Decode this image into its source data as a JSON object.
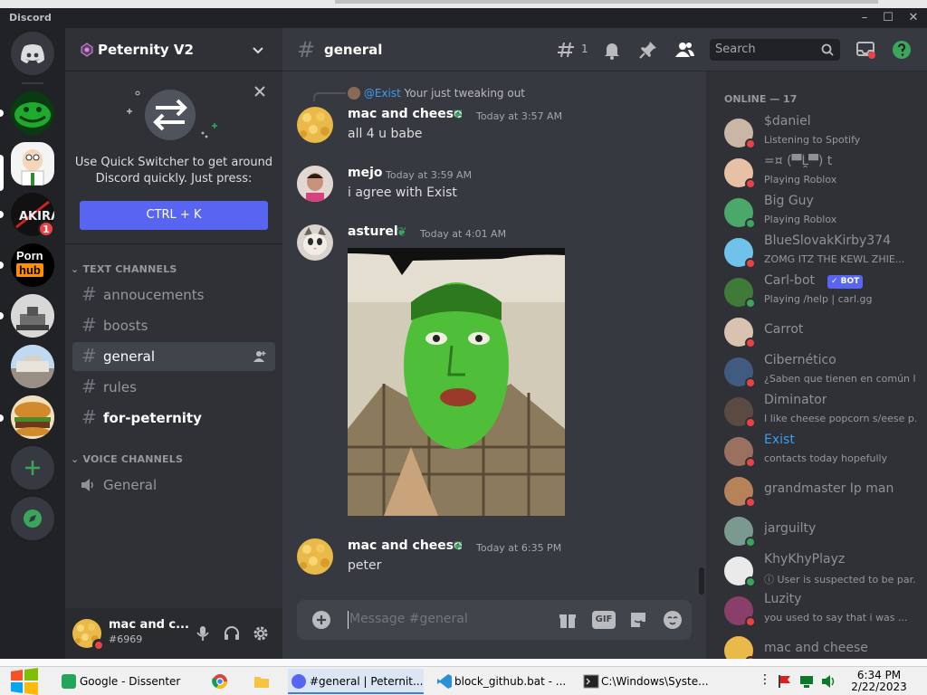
{
  "window": {
    "brand": "Discord",
    "minimize": "–",
    "maximize": "☐",
    "close": "✕"
  },
  "servers": {
    "badge_akira": "1",
    "porn_line1": "Porn",
    "porn_line2": "hub"
  },
  "guild": {
    "name": "Peternity V2",
    "quick_switcher_text": "Use Quick Switcher to get around Discord quickly. Just press:",
    "quick_switcher_button": "CTRL + K"
  },
  "categories": {
    "text": "TEXT CHANNELS",
    "voice": "VOICE CHANNELS"
  },
  "text_channels": [
    {
      "name": "annoucements"
    },
    {
      "name": "boosts"
    },
    {
      "name": "general"
    },
    {
      "name": "rules"
    },
    {
      "name": "for-peternity"
    }
  ],
  "voice_channels": [
    {
      "name": "General"
    }
  ],
  "user": {
    "name": "mac and c...",
    "tag": "#6969"
  },
  "chat": {
    "channel": "general",
    "threads_count": "1",
    "search_placeholder": "Search",
    "composer_placeholder": "Message #general",
    "gif_label": "GIF"
  },
  "messages": [
    {
      "reply_to": "@Exist",
      "reply_text": "Your just tweaking out",
      "author": "mac and cheese",
      "time": "Today at 3:57 AM",
      "text": "all 4 u babe"
    },
    {
      "author": "mejo",
      "time": "Today at 3:59 AM",
      "text": "i agree with Exist"
    },
    {
      "author": "asturel",
      "time": "Today at 4:01 AM",
      "text": ""
    },
    {
      "author": "mac and cheese",
      "time": "Today at 6:35 PM",
      "text": "peter"
    }
  ],
  "members": {
    "header": "ONLINE — 17",
    "list": [
      {
        "name": "$daniel",
        "status": "Listening to Spotify",
        "color": "#8e9297",
        "presence": "#ed4245"
      },
      {
        "name": "=¤ (▀̿Ĺ̯▀̿) t",
        "status": "Playing Roblox",
        "color": "#8e9297",
        "presence": "#ed4245"
      },
      {
        "name": "Big Guy",
        "status": "Playing Roblox",
        "color": "#8e9297",
        "presence": "#3ba55d"
      },
      {
        "name": "BlueSlovakKirby374",
        "status": "ZOMG ITZ THE KEWL ZHIE...",
        "color": "#8e9297",
        "presence": "#ed4245"
      },
      {
        "name": "Carl-bot",
        "bot": "✓ BOT",
        "status": "Playing /help | carl.gg",
        "color": "#8e9297",
        "presence": "#3ba55d"
      },
      {
        "name": "Carrot",
        "status": "",
        "color": "#8e9297",
        "presence": "#ed4245"
      },
      {
        "name": "Cibernético",
        "status": "¿Saben que tienen en común l...",
        "color": "#8e9297",
        "presence": "#ed4245"
      },
      {
        "name": "Diminator",
        "status": "I like cheese popcorn s/eese p...",
        "color": "#8e9297",
        "presence": "#ed4245"
      },
      {
        "name": "Exist",
        "status": "contacts today hopefully",
        "color": "#3d9cf0",
        "presence": "#ed4245"
      },
      {
        "name": "grandmaster Ip man",
        "status": "",
        "color": "#8e9297",
        "presence": "#ed4245"
      },
      {
        "name": "jarguilty",
        "status": "",
        "color": "#8e9297",
        "presence": "#3ba55d"
      },
      {
        "name": "KhyKhyPlayz",
        "status": "ⓘ User is suspected to be par...",
        "color": "#8e9297",
        "presence": "#3ba55d"
      },
      {
        "name": "Luzity",
        "status": "you used to say that i was ...",
        "color": "#8e9297",
        "presence": "#ed4245"
      },
      {
        "name": "mac and cheese",
        "status": "",
        "color": "#8e9297",
        "presence": "#ed4245"
      }
    ]
  },
  "taskbar": {
    "items": [
      {
        "label": "Google - Dissenter"
      },
      {
        "label": "#general | Peternit..."
      },
      {
        "label": "block_github.bat - ..."
      },
      {
        "label": "C:\\Windows\\Syste..."
      }
    ],
    "time": "6:34 PM",
    "date": "2/22/2023"
  }
}
